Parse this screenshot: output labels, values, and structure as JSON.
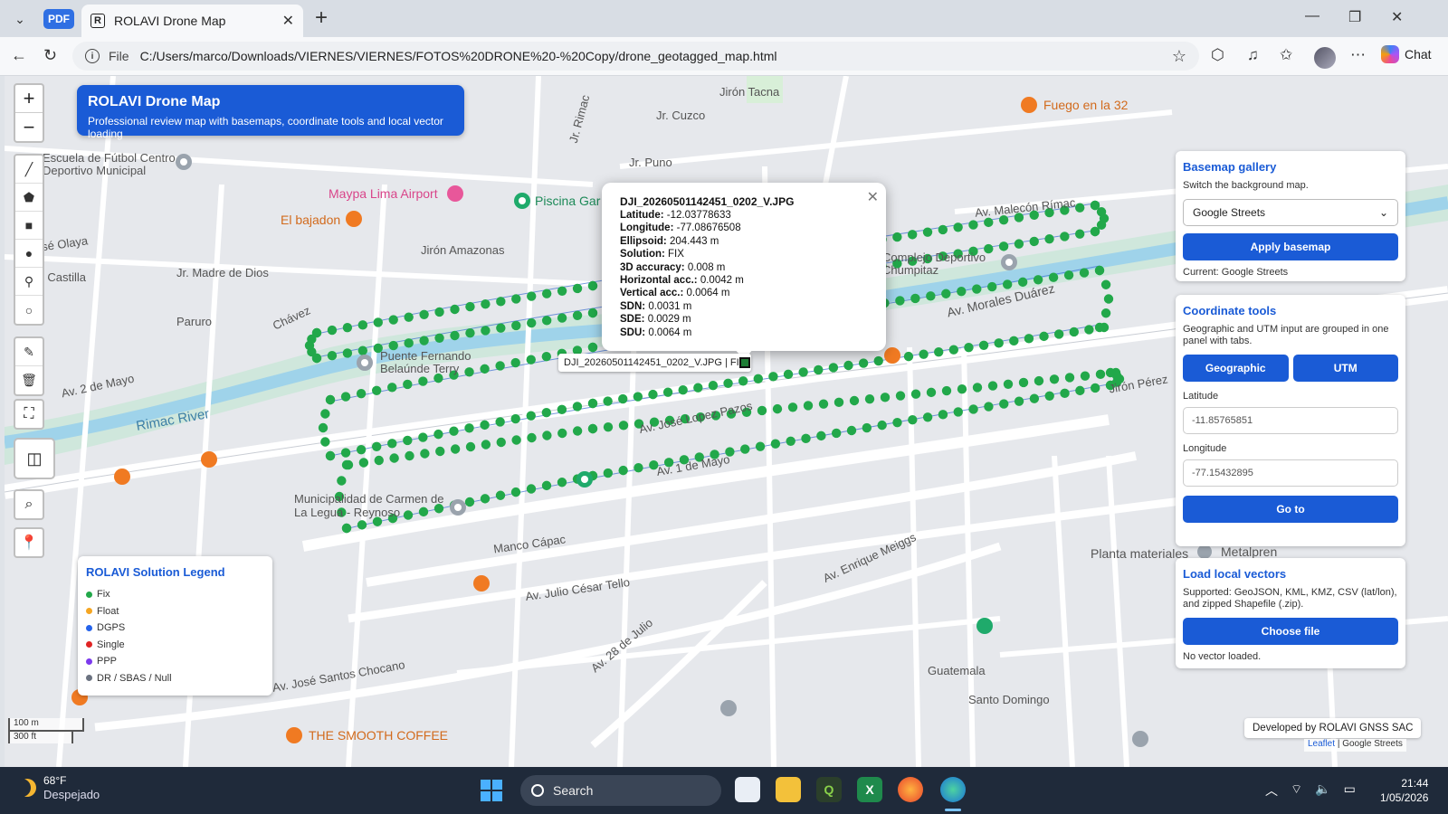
{
  "browser": {
    "pdf_badge": "PDF",
    "tab_favicon": "R",
    "tab_title": "ROLAVI Drone Map",
    "url_scheme": "File",
    "url": "C:/Users/marco/Downloads/VIERNES/VIERNES/FOTOS%20DRONE%20-%20Copy/drone_geotagged_map.html",
    "chat_label": "Chat"
  },
  "app": {
    "title": "ROLAVI Drone Map",
    "subtitle": "Professional review map with basemaps, coordinate tools and local vector loading"
  },
  "popup": {
    "filename": "DJI_20260501142451_0202_V.JPG",
    "rows": [
      {
        "label": "Latitude:",
        "value": "-12.03778633"
      },
      {
        "label": "Longitude:",
        "value": "-77.08676508"
      },
      {
        "label": "Ellipsoid:",
        "value": "204.443 m"
      },
      {
        "label": "Solution:",
        "value": "FIX"
      },
      {
        "label": "3D accuracy:",
        "value": "0.008 m"
      },
      {
        "label": "Horizontal acc.:",
        "value": "0.0042 m"
      },
      {
        "label": "Vertical acc.:",
        "value": "0.0064 m"
      },
      {
        "label": "SDN:",
        "value": "0.0031 m"
      },
      {
        "label": "SDE:",
        "value": "0.0029 m"
      },
      {
        "label": "SDU:",
        "value": "0.0064 m"
      }
    ],
    "tooltip": "DJI_20260501142451_0202_V.JPG | FIX"
  },
  "legend": {
    "title": "ROLAVI Solution Legend",
    "items": [
      {
        "label": "Fix",
        "color": "#22a84a"
      },
      {
        "label": "Float",
        "color": "#f5a623"
      },
      {
        "label": "DGPS",
        "color": "#2563eb"
      },
      {
        "label": "Single",
        "color": "#e02424"
      },
      {
        "label": "PPP",
        "color": "#7c3aed"
      },
      {
        "label": "DR / SBAS / Null",
        "color": "#6b7280"
      }
    ]
  },
  "basemap": {
    "title": "Basemap gallery",
    "desc": "Switch the background map.",
    "selected": "Google Streets",
    "apply_label": "Apply basemap",
    "current": "Current: Google Streets"
  },
  "coords": {
    "title": "Coordinate tools",
    "desc": "Geographic and UTM input are grouped in one panel with tabs.",
    "tab_geo": "Geographic",
    "tab_utm": "UTM",
    "lat_label": "Latitude",
    "lat_value": "-11.85765851",
    "lon_label": "Longitude",
    "lon_value": "-77.15432895",
    "go_label": "Go to"
  },
  "vectors": {
    "title": "Load local vectors",
    "desc": "Supported: GeoJSON, KML, KMZ, CSV (lat/lon), and zipped Shapefile (.zip).",
    "choose_label": "Choose file",
    "status": "No vector loaded."
  },
  "map_labels": {
    "streets": [
      {
        "text": "Jr. Cuzco"
      },
      {
        "text": "Jirón Tacna"
      },
      {
        "text": "Jr. Puno"
      },
      {
        "text": "Jr. Rimac"
      },
      {
        "text": "Jr. Madre de Dios"
      },
      {
        "text": "Jirón Amazonas"
      },
      {
        "text": "Jr. Castilla"
      },
      {
        "text": "Paruro"
      },
      {
        "text": "Av. 2 de Mayo"
      },
      {
        "text": "Rimac River"
      },
      {
        "text": "Av. José Lopez Pazos"
      },
      {
        "text": "Av. 1 de Mayo"
      },
      {
        "text": "Manco Cápac"
      },
      {
        "text": "Av. Enrique Meiggs"
      },
      {
        "text": "Av. Julio César Tello"
      },
      {
        "text": "Av. 28 de Julio"
      },
      {
        "text": "Av. José Santos Chocano"
      },
      {
        "text": "Guatemala"
      },
      {
        "text": "Santo Domingo"
      },
      {
        "text": "Av. Morales Duárez"
      },
      {
        "text": "Av. Malecón Rímac"
      },
      {
        "text": "Jirón Pérez"
      },
      {
        "text": "Jr. José Olaya"
      },
      {
        "text": "Chávez"
      }
    ],
    "pois": [
      {
        "text": "Maypa Lima Airport"
      },
      {
        "text": "El bajadon"
      },
      {
        "text": "Fuego en la 32"
      },
      {
        "text": "Piscina Gar"
      },
      {
        "text": "THE SMOOTH COFFEE"
      },
      {
        "text": "Planta materiales"
      },
      {
        "text": "Metalpren"
      },
      {
        "text": "Municipalidad de Carmen de La Legua - Reynoso"
      },
      {
        "text": "Puente Fernando Belaúnde Terry"
      },
      {
        "text": "Escuela de Fútbol Centro Deportivo Municipal"
      },
      {
        "text": "Complejo Deportivo Chumpitaz"
      }
    ]
  },
  "scale": {
    "metric": "100 m",
    "imperial": "300 ft"
  },
  "footer": {
    "developer": "Developed by ROLAVI GNSS SAC",
    "attribution_link": "Leaflet",
    "attribution_rest": "| Google Streets"
  },
  "taskbar": {
    "temp": "68°F",
    "weather": "Despejado",
    "search": "Search",
    "time": "21:44",
    "date": "1/05/2026"
  },
  "colors": {
    "accent": "#1a5bd6",
    "fix": "#22a84a"
  }
}
